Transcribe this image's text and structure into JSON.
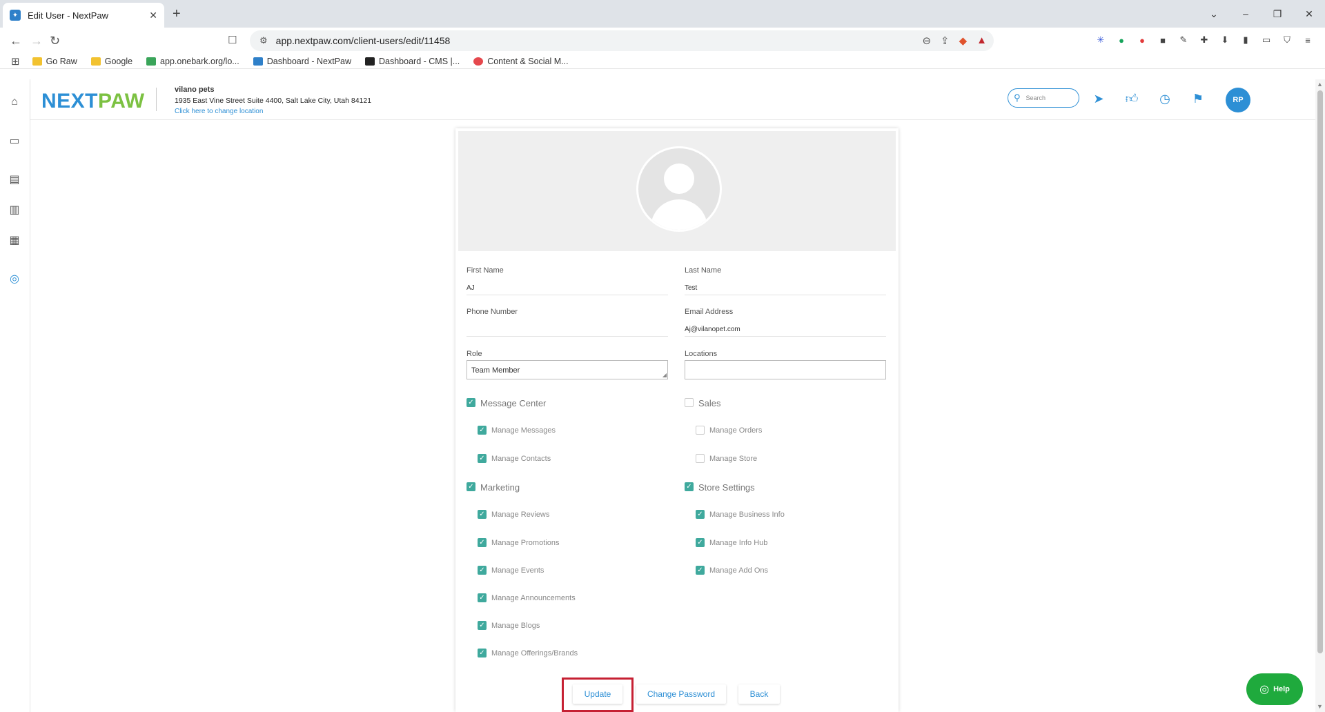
{
  "browser": {
    "tab_title": "Edit User - NextPaw",
    "url": "app.nextpaw.com/client-users/edit/11458",
    "bookmarks": [
      "Go Raw",
      "Google",
      "app.onebark.org/lo...",
      "Dashboard - NextPaw",
      "Dashboard - CMS |...",
      "Content & Social M..."
    ]
  },
  "header": {
    "logo_next": "NEXT",
    "logo_paw": "PAW",
    "location_name": "vilano pets",
    "location_address": "1935 East Vine Street Suite 4400, Salt Lake City, Utah 84121",
    "change_location": "Click here to change location",
    "search_placeholder": "Search",
    "avatar_initials": "RP"
  },
  "form": {
    "first_name_label": "First Name",
    "first_name_value": "AJ",
    "last_name_label": "Last Name",
    "last_name_value": "Test",
    "phone_label": "Phone Number",
    "phone_value": "",
    "email_label": "Email Address",
    "email_value": "Aj@vilanopet.com",
    "role_label": "Role",
    "role_value": "Team Member",
    "locations_label": "Locations",
    "locations_value": ""
  },
  "permissions": {
    "message_center": {
      "label": "Message Center",
      "checked": true,
      "items": [
        {
          "label": "Manage Messages",
          "checked": true
        },
        {
          "label": "Manage Contacts",
          "checked": true
        }
      ]
    },
    "sales": {
      "label": "Sales",
      "checked": false,
      "items": [
        {
          "label": "Manage Orders",
          "checked": false
        },
        {
          "label": "Manage Store",
          "checked": false
        }
      ]
    },
    "marketing": {
      "label": "Marketing",
      "checked": true,
      "items": [
        {
          "label": "Manage Reviews",
          "checked": true
        },
        {
          "label": "Manage Promotions",
          "checked": true
        },
        {
          "label": "Manage Events",
          "checked": true
        },
        {
          "label": "Manage Announcements",
          "checked": true
        },
        {
          "label": "Manage Blogs",
          "checked": true
        },
        {
          "label": "Manage Offerings/Brands",
          "checked": true
        }
      ]
    },
    "store_settings": {
      "label": "Store Settings",
      "checked": true,
      "items": [
        {
          "label": "Manage Business Info",
          "checked": true
        },
        {
          "label": "Manage Info Hub",
          "checked": true
        },
        {
          "label": "Manage Add Ons",
          "checked": true
        }
      ]
    }
  },
  "actions": {
    "update": "Update",
    "change_password": "Change Password",
    "back": "Back"
  },
  "help_label": "Help",
  "colors": {
    "brand_blue": "#2d8fd5",
    "brand_green": "#7cc142",
    "check_teal": "#3fa99d",
    "help_green": "#1faa3d",
    "highlight_red": "#c62033"
  }
}
